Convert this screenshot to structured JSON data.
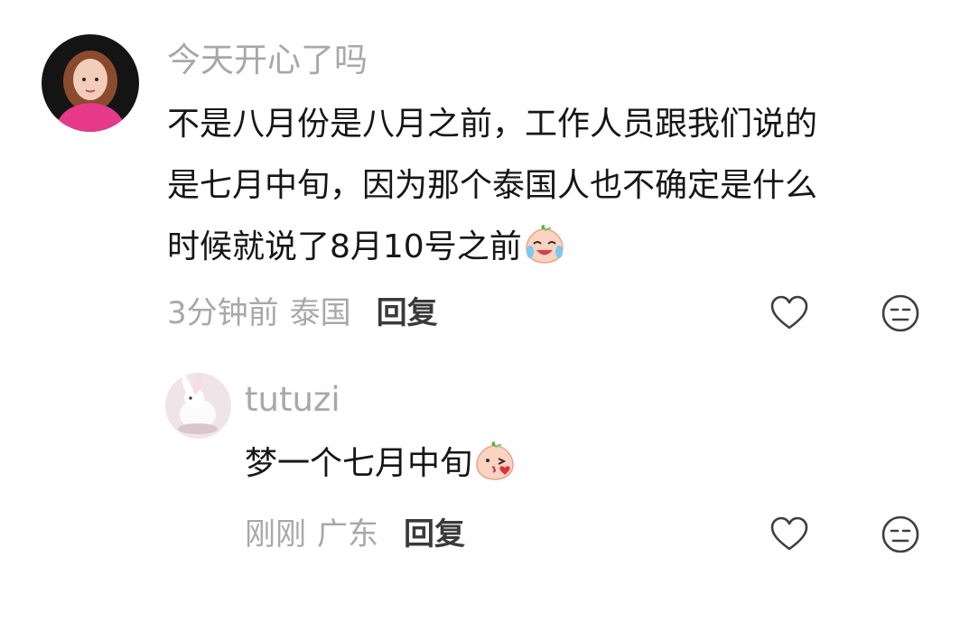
{
  "comment": {
    "username": "今天开心了吗",
    "text_lines": [
      "不是八月份是八月之前，工作人员跟我们说的",
      "是七月中旬，因为那个泰国人也不确定是什么",
      "时候就说了8月10号之前"
    ],
    "emoji_icon": "crying-laughing-peach-emoji",
    "time": "3分钟前",
    "location": "泰国",
    "reply_label": "回复",
    "like_icon": "heart-outline-icon",
    "dislike_icon": "meh-face-icon"
  },
  "reply": {
    "username": "tutuzi",
    "text": "梦一个七月中旬",
    "emoji_icon": "kissing-peach-emoji",
    "time": "刚刚",
    "location": "广东",
    "reply_label": "回复",
    "like_icon": "heart-outline-icon",
    "dislike_icon": "meh-face-icon"
  },
  "colors": {
    "username": "#a8a8a8",
    "body_text": "#161616",
    "meta": "#a8a8a8",
    "reply_button": "#3a3a3a",
    "icon_stroke": "#3f3f3f"
  }
}
